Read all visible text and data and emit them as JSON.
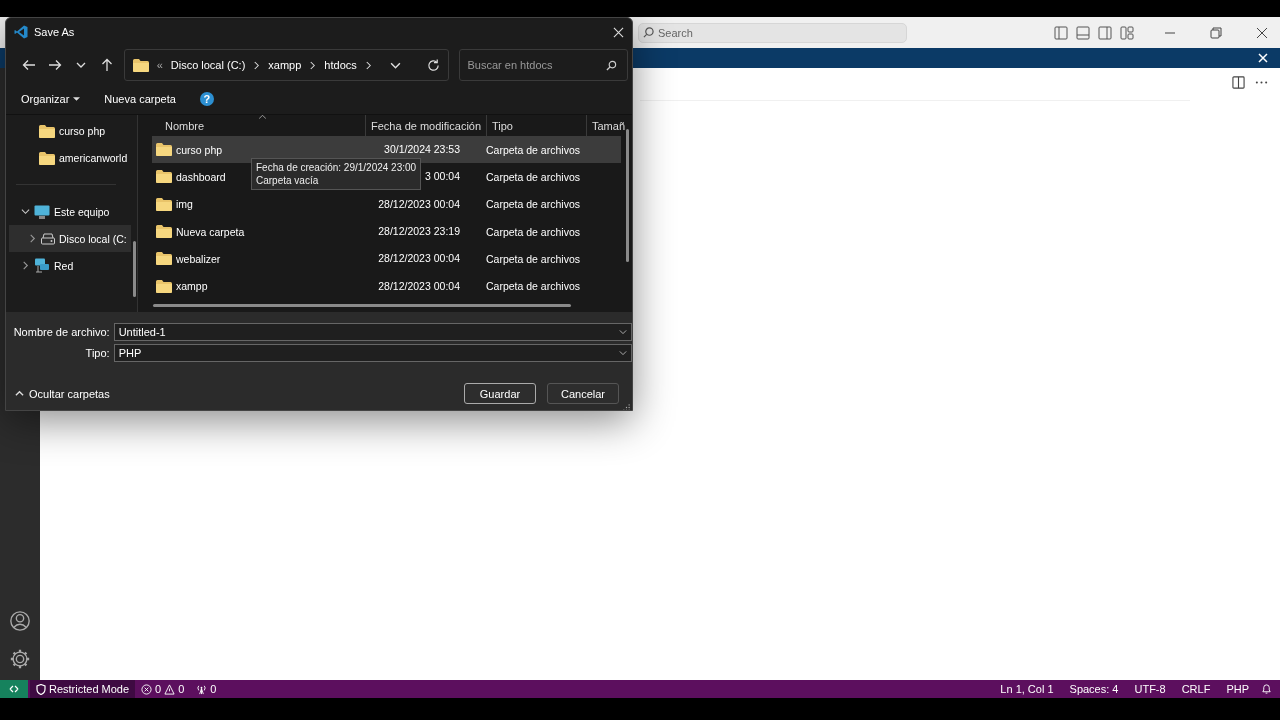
{
  "vscode": {
    "search_placeholder": "Search",
    "status_bar": {
      "restricted": "Restricted Mode",
      "errors": "0",
      "warnings": "0",
      "ports": "0",
      "right": [
        "Ln 1, Col 1",
        "Spaces: 4",
        "UTF-8",
        "CRLF",
        "PHP"
      ]
    }
  },
  "dialog": {
    "title": "Save As",
    "address": {
      "overflow": "«",
      "crumbs": [
        "Disco local (C:)",
        "xampp",
        "htdocs"
      ]
    },
    "search_placeholder": "Buscar en htdocs",
    "toolbar": {
      "organize": "Organizar",
      "new_folder": "Nueva carpeta",
      "help": "?"
    },
    "nav": {
      "pinned": [
        {
          "label": "curso php",
          "kind": "folder",
          "selected": false
        },
        {
          "label": "americanworld",
          "kind": "folder",
          "selected": false
        }
      ],
      "tree": [
        {
          "label": "Este equipo",
          "kind": "computer",
          "expanded": true,
          "selected": false,
          "children": [
            {
              "label": "Disco local (C:",
              "kind": "drive",
              "expanded": false,
              "selected": true
            }
          ]
        },
        {
          "label": "Red",
          "kind": "network",
          "expanded": false,
          "selected": false
        }
      ]
    },
    "files": {
      "columns": [
        "Nombre",
        "Fecha de modificación",
        "Tipo",
        "Tamañ"
      ],
      "rows": [
        {
          "name": "curso php",
          "date": "30/1/2024 23:53",
          "type": "Carpeta de archivos",
          "selected": true
        },
        {
          "name": "dashboard",
          "date": "3 00:04",
          "type": "Carpeta de archivos",
          "selected": false
        },
        {
          "name": "img",
          "date": "28/12/2023 00:04",
          "type": "Carpeta de archivos",
          "selected": false
        },
        {
          "name": "Nueva carpeta",
          "date": "28/12/2023 23:19",
          "type": "Carpeta de archivos",
          "selected": false
        },
        {
          "name": "webalizer",
          "date": "28/12/2023 00:04",
          "type": "Carpeta de archivos",
          "selected": false
        },
        {
          "name": "xampp",
          "date": "28/12/2023 00:04",
          "type": "Carpeta de archivos",
          "selected": false
        }
      ],
      "tooltip": [
        "Fecha de creación: 29/1/2024 23:00",
        "Carpeta vacía"
      ]
    },
    "filename": {
      "label": "Nombre de archivo:",
      "value": "Untitled-1"
    },
    "filetype": {
      "label": "Tipo:",
      "value": "PHP"
    },
    "buttons": [
      {
        "label": "Guardar",
        "default": true
      },
      {
        "label": "Cancelar",
        "default": false
      }
    ],
    "hide_folders": "Ocultar carpetas"
  }
}
